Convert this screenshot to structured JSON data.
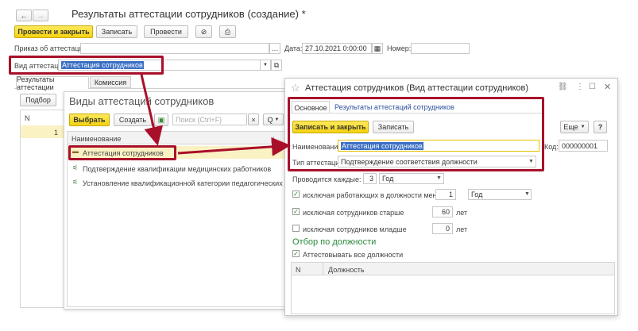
{
  "main": {
    "title": "Результаты аттестации сотрудников (создание) *",
    "toolbar": {
      "post_close": "Провести и закрыть",
      "save": "Записать",
      "post": "Провести"
    },
    "order_label": "Приказ об аттестации:",
    "order_value": "",
    "date_label": "Дата:",
    "date_value": "27.10.2021  0:00:00",
    "number_label": "Номер:",
    "number_value": "",
    "type_label": "Вид аттестации:",
    "type_value": "Аттестация сотрудников",
    "tabs": [
      "Результаты аттестации",
      "Комиссия"
    ],
    "select_button": "Подбор",
    "col_n": "N",
    "row_number": "1"
  },
  "picker": {
    "title": "Виды аттестаций сотрудников",
    "choose": "Выбрать",
    "create": "Создать",
    "search_placeholder": "Поиск (Ctrl+F)",
    "clear": "×",
    "search_icon": "Q",
    "header": "Наименование",
    "sort_indicator": "↓",
    "items": [
      "Аттестация сотрудников",
      "Подтверждение квалификации медицинских работников",
      "Установление квалификационной категории педагогических раб..."
    ]
  },
  "detail": {
    "title": "Аттестация сотрудников (Вид аттестации сотрудников)",
    "tabs": [
      "Основное",
      "Результаты аттестаций сотрудников"
    ],
    "save_close": "Записать и закрыть",
    "save": "Записать",
    "more": "Еще",
    "help": "?",
    "name_label": "Наименование:",
    "name_value": "Аттестация сотрудников",
    "code_label": "Код:",
    "code_value": "000000001",
    "type_label": "Тип аттестации:",
    "type_value": "Подтверждение соответствия должности",
    "every_label": "Проводится каждые:",
    "every_value": "3",
    "every_unit": "Год",
    "excl_worked_label": "исключая работающих в должности менее",
    "excl_worked_value": "1",
    "excl_worked_unit": "Год",
    "excl_older_label": "исключая сотрудников старше",
    "excl_older_value": "60",
    "excl_older_unit": "лет",
    "excl_younger_label": "исключая сотрудников младше",
    "excl_younger_value": "0",
    "excl_younger_unit": "лет",
    "filter_heading": "Отбор по должности",
    "all_positions_label": "Аттестовывать все должности",
    "table_col_n": "N",
    "table_col_position": "Должность"
  },
  "colors": {
    "accent_yellow": "#f5d210",
    "highlight_red": "#a8102a",
    "selection_blue": "#3b6fc4",
    "green_heading": "#2a8a3a"
  },
  "icons": [
    "back-arrow-icon",
    "forward-arrow-icon",
    "paperclip-icon",
    "printer-icon",
    "star-icon",
    "link-icon",
    "more-icon",
    "maximize-icon",
    "close-icon",
    "calendar-icon",
    "copy-icon",
    "dropdown-icon",
    "search-icon",
    "folder-icon",
    "item-icon"
  ]
}
